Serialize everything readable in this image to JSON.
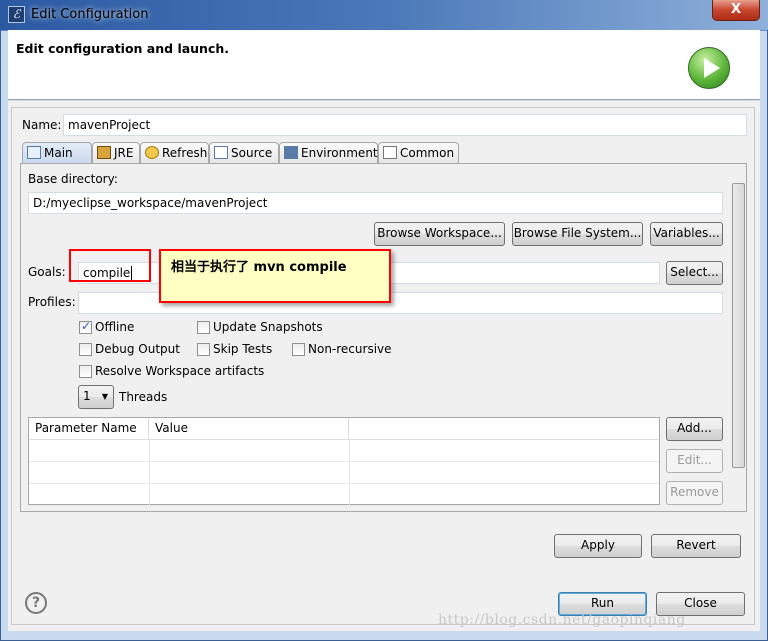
{
  "window": {
    "title": "Edit Configuration",
    "close_label": "X"
  },
  "header": {
    "title": "Edit configuration and launch."
  },
  "name": {
    "label": "Name:",
    "value": "mavenProject"
  },
  "tabs": [
    {
      "label": "Main",
      "active": true
    },
    {
      "label": "JRE"
    },
    {
      "label": "Refresh"
    },
    {
      "label": "Source"
    },
    {
      "label": "Environment"
    },
    {
      "label": "Common"
    }
  ],
  "main": {
    "base_dir_label": "Base directory:",
    "base_dir_value": "D:/myeclipse_workspace/mavenProject",
    "browse_workspace": "Browse Workspace...",
    "browse_fs": "Browse File System...",
    "variables": "Variables...",
    "goals_label": "Goals:",
    "goals_value": "compile",
    "select": "Select...",
    "profiles_label": "Profiles:",
    "profiles_value": "",
    "checkboxes": [
      {
        "label": "Offline",
        "checked": true
      },
      {
        "label": "Update Snapshots",
        "checked": false
      },
      {
        "label": "Debug Output",
        "checked": false
      },
      {
        "label": "Skip Tests",
        "checked": false
      },
      {
        "label": "Non-recursive",
        "checked": false
      },
      {
        "label": "Resolve Workspace artifacts",
        "checked": false
      }
    ],
    "threads_value": "1",
    "threads_label": "Threads",
    "table_headers": [
      "Parameter Name",
      "Value"
    ],
    "add": "Add...",
    "edit": "Edit...",
    "remove": "Remove"
  },
  "annotation": {
    "text": "相当于执行了 mvn compile",
    "color": "#ff0000"
  },
  "footer": {
    "apply": "Apply",
    "revert": "Revert",
    "run": "Run",
    "close": "Close",
    "help": "?"
  },
  "watermark": "http://blog.csdn.net/gaopinqiang"
}
